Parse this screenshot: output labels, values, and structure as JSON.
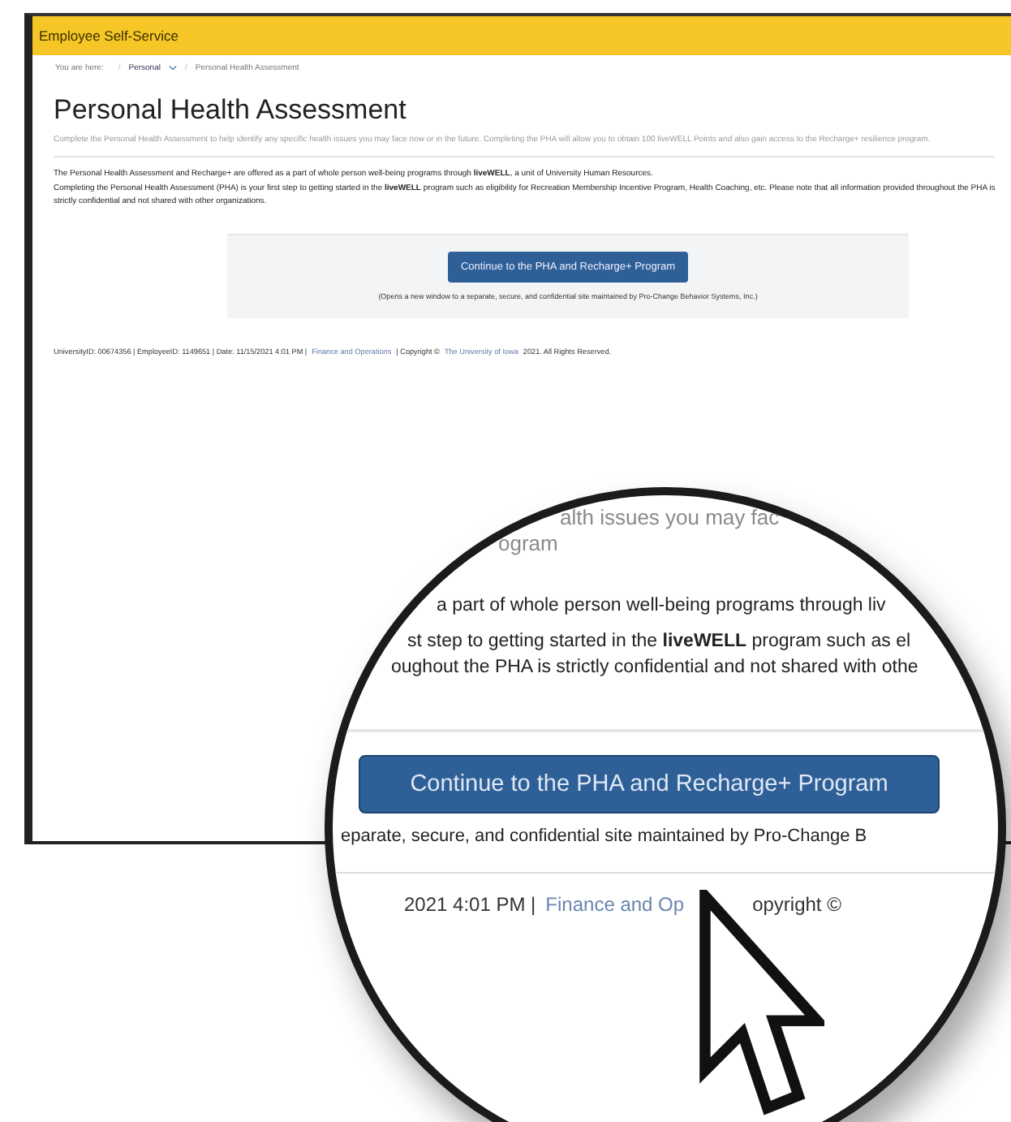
{
  "header": {
    "title": "Employee Self-Service"
  },
  "breadcrumb": {
    "label": "You are here:",
    "separator": "/",
    "items": [
      {
        "text": "Personal",
        "dropdown": true
      },
      {
        "text": "Personal Health Assessment",
        "dropdown": false
      }
    ]
  },
  "page": {
    "title": "Personal Health Assessment",
    "intro": "Complete the Personal Health Assessment to help identify any specific health issues you may face now or in the future. Completing the PHA will allow you to obtain 100 liveWELL Points and also gain access to the Recharge+ resilience program.",
    "paragraphs": [
      "The Personal Health Assessment and Recharge+ are offered as a part of whole person well-being programs through **liveWELL**, a unit of University Human Resources.",
      "Completing the Personal Health Assessment (PHA) is your first step to getting started in the **liveWELL** program such as eligibility for Recreation Membership Incentive Program, Health Coaching, etc.   Please note that all information provided throughout the PHA is strictly confidential and not shared with other organizations."
    ],
    "cta": {
      "button": "Continue to the PHA and Recharge+ Program",
      "note": "(Opens a new window to a separate, secure, and confidential site maintained by Pro-Change Behavior Systems, Inc.)"
    },
    "footer": [
      {
        "kind": "text",
        "text": "UniversityID: 00674356  |  EmployeeID: 1149651  |  Date: 11/15/2021 4:01 PM  |"
      },
      {
        "kind": "link",
        "text": "Finance and Operations"
      },
      {
        "kind": "text",
        "text": "|  Copyright ©"
      },
      {
        "kind": "link",
        "text": "The University of Iowa"
      },
      {
        "kind": "text",
        "text": "2021. All Rights Reserved."
      }
    ]
  },
  "magnifier": {
    "lines": [
      {
        "kind": "faint",
        "text": "alth issues you may fac"
      },
      {
        "kind": "faint",
        "text": "ogram"
      },
      {
        "kind": "body",
        "text": "a part of whole person well-being programs through liv"
      },
      {
        "kind": "body",
        "text": "st step to getting started in the **liveWELL** program such as el"
      },
      {
        "kind": "body",
        "text": "oughout the PHA is strictly confidential and not shared with othe"
      }
    ],
    "button": "Continue to the PHA and Recharge+ Program",
    "note": "eparate, secure, and confidential site maintained by Pro-Change B",
    "footer": [
      {
        "kind": "text",
        "text": "2021  4:01 PM  |"
      },
      {
        "kind": "link",
        "text": "Finance and Op"
      },
      {
        "kind": "text",
        "text": "opyright ©"
      }
    ]
  }
}
